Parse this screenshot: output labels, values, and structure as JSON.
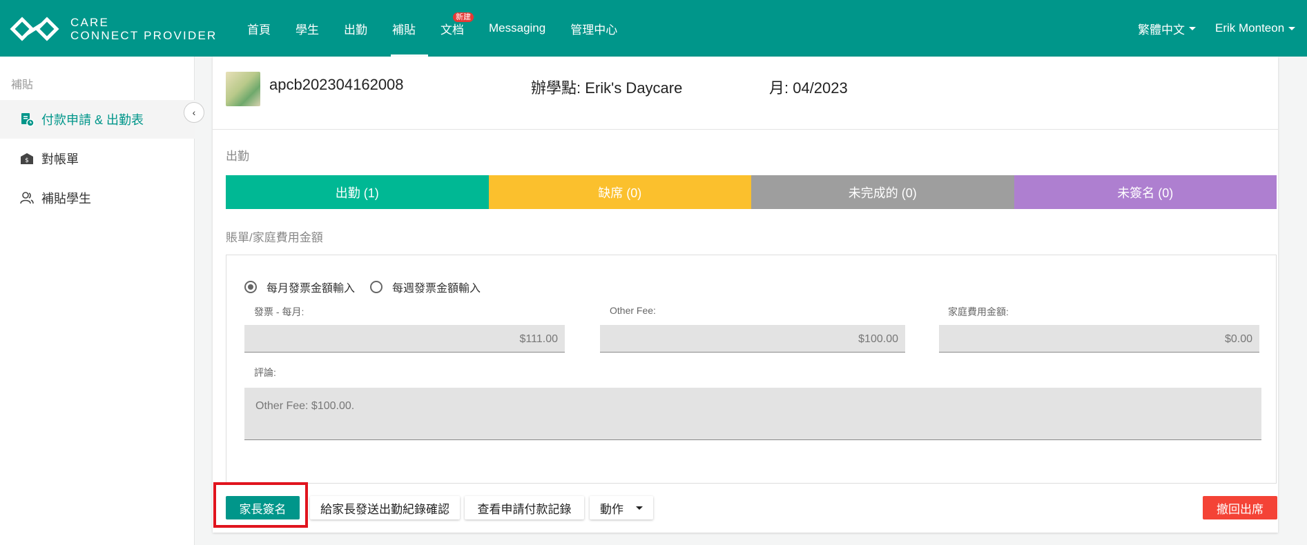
{
  "header": {
    "logo_line1": "CARE",
    "logo_line2": "CONNECT PROVIDER",
    "nav": [
      {
        "label": "首頁"
      },
      {
        "label": "學生"
      },
      {
        "label": "出勤"
      },
      {
        "label": "補貼",
        "active": true
      },
      {
        "label": "文档",
        "badge": "新建"
      },
      {
        "label": "Messaging"
      },
      {
        "label": "管理中心"
      }
    ],
    "language": "繁體中文",
    "user": "Erik Monteon",
    "brand_color": "#00968a"
  },
  "sidebar": {
    "heading": "補貼",
    "items": [
      {
        "label": "付款申請 & 出勤表",
        "icon": "clipboard-clock-icon",
        "active": true
      },
      {
        "label": "對帳單",
        "icon": "dollar-building-icon"
      },
      {
        "label": "補貼學生",
        "icon": "users-icon"
      }
    ],
    "collapse_icon": "chevron-left-icon"
  },
  "record": {
    "case_id": "apcb202304162008",
    "site": "辦學點: Erik's Daycare",
    "month": "月: 04/2023"
  },
  "attendance": {
    "label": "出勤",
    "segments": [
      {
        "label": "出勤 (1)",
        "color": "#00b894"
      },
      {
        "label": "缺席 (0)",
        "color": "#fbc02d"
      },
      {
        "label": "未完成的 (0)",
        "color": "#9e9e9e"
      },
      {
        "label": "未簽名 (0)",
        "color": "#ae7fd0"
      }
    ]
  },
  "fees": {
    "label": "賬單/家庭費用金額",
    "radio_monthly": "每月發票金額輸入",
    "radio_weekly": "每週發票金額輸入",
    "selected": "monthly",
    "invoice_label": "發票 - 每月:",
    "invoice_value": "$111.00",
    "other_fee_label": "Other Fee:",
    "other_fee_value": "$100.00",
    "family_fee_label": "家庭費用金額:",
    "family_fee_value": "$0.00",
    "comment_label": "評論:",
    "comment_value": "Other Fee: $100.00."
  },
  "actions": {
    "parent_sign": "家長簽名",
    "send_confirm": "給家長發送出勤紀錄確認",
    "view_history": "查看申請付款記錄",
    "action_menu": "動作",
    "withdraw": "撤回出席",
    "danger_color": "#f44336",
    "highlight_color": "#e0141e"
  }
}
